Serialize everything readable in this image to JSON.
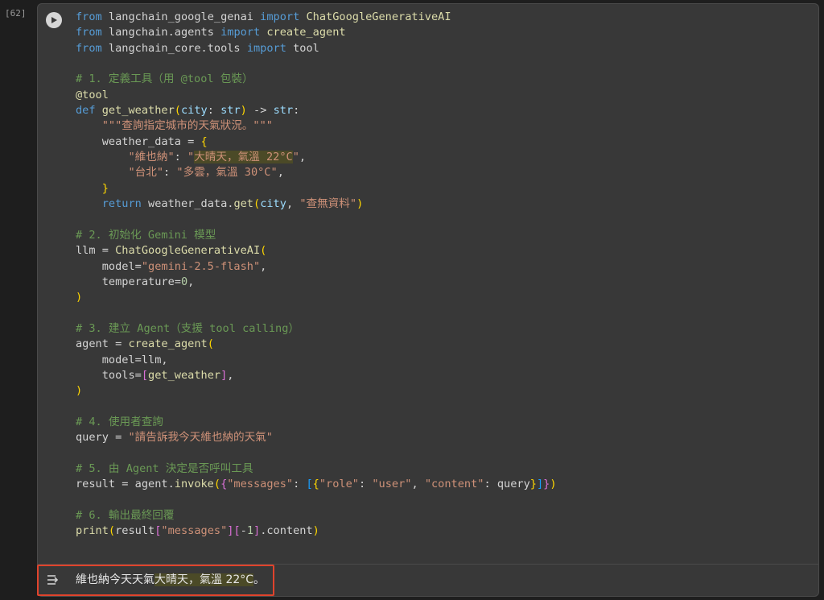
{
  "cell": {
    "execution_count": "[62]",
    "code_lines": [
      "from langchain_google_genai import ChatGoogleGenerativeAI",
      "from langchain.agents import create_agent",
      "from langchain_core.tools import tool",
      "",
      "# 1. 定義工具（用 @tool 包裝）",
      "@tool",
      "def get_weather(city: str) -> str:",
      "    \"\"\"查詢指定城市的天氣狀況。\"\"\"",
      "    weather_data = {",
      "        \"維也納\": \"大晴天，氣溫 22°C\",",
      "        \"台北\": \"多雲，氣溫 30°C\",",
      "    }",
      "    return weather_data.get(city, \"查無資料\")",
      "",
      "# 2. 初始化 Gemini 模型",
      "llm = ChatGoogleGenerativeAI(",
      "    model=\"gemini-2.5-flash\",",
      "    temperature=0,",
      ")",
      "",
      "# 3. 建立 Agent（支援 tool calling）",
      "agent = create_agent(",
      "    model=llm,",
      "    tools=[get_weather],",
      ")",
      "",
      "# 4. 使用者查詢",
      "query = \"請告訴我今天維也納的天氣\"",
      "",
      "# 5. 由 Agent 決定是否呼叫工具",
      "result = agent.invoke({\"messages\": [{\"role\": \"user\", \"content\": query}]})",
      "",
      "# 6. 輸出最終回覆",
      "print(result[\"messages\"][-1].content)"
    ]
  },
  "output": {
    "text_before": "維也納今天天氣",
    "text_highlight": "大晴天，氣溫 22°C",
    "text_after": "。"
  },
  "icons": {
    "run": "play-icon",
    "output": "output-expand-icon"
  },
  "colors": {
    "highlight_box": "#e0432c"
  }
}
